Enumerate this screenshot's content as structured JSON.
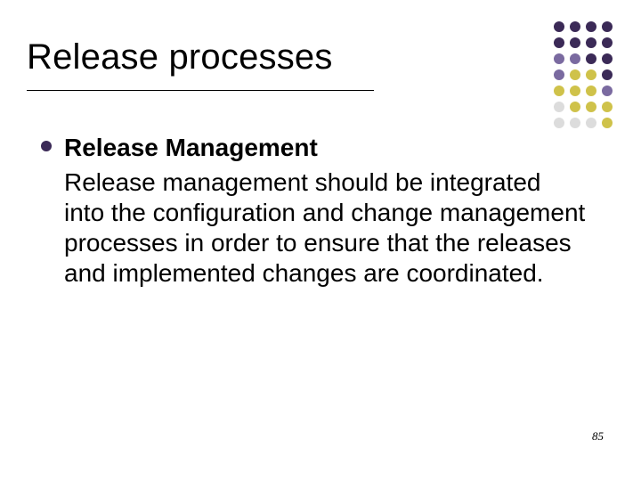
{
  "title": "Release processes",
  "bullet": {
    "heading": "Release Management",
    "body": "Release management should be integrated into the configuration and change management processes in order to ensure that the releases and implemented changes are coordinated."
  },
  "page_number": "85",
  "dots": {
    "colors": [
      "#3b2a57",
      "#3b2a57",
      "#3b2a57",
      "#3b2a57",
      "#3b2a57",
      "#3b2a57",
      "#3b2a57",
      "#3b2a57",
      "#7a6aa0",
      "#7a6aa0",
      "#3b2a57",
      "#3b2a57",
      "#7a6aa0",
      "#cfc24a",
      "#cfc24a",
      "#3b2a57",
      "#cfc24a",
      "#cfc24a",
      "#cfc24a",
      "#7a6aa0",
      "#dcdcdc",
      "#cfc24a",
      "#cfc24a",
      "#cfc24a",
      "#dcdcdc",
      "#dcdcdc",
      "#dcdcdc",
      "#cfc24a"
    ]
  }
}
